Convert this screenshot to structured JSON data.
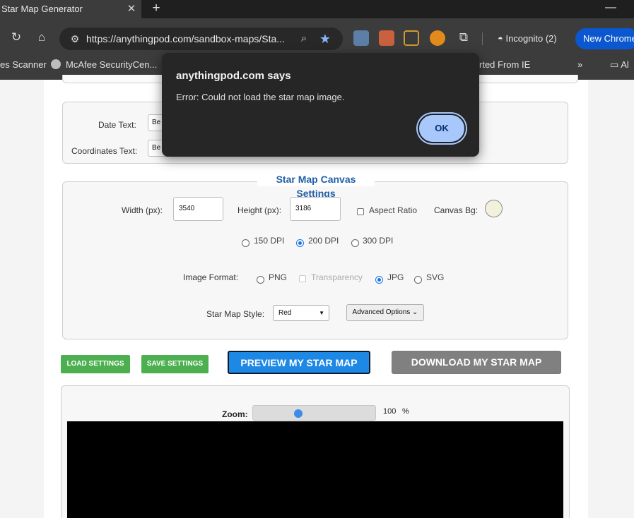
{
  "browser": {
    "tab_title": "Star Map Generator",
    "tab_close": "✕",
    "new_tab": "+",
    "minimize": "—",
    "url": "https://anythingpod.com/sandbox-maps/Sta...",
    "incognito_label": "Incognito (2)",
    "new_chrome_label": "New Chrome",
    "bookmarks": [
      "es Scanner",
      "McAfee SecurityCen...",
      "rted From IE",
      "Al"
    ],
    "bookmarks_overflow": "»"
  },
  "text_settings": {
    "date_label": "Date Text:",
    "date_value": "Be",
    "coords_label": "Coordinates Text:",
    "coords_value": "Be"
  },
  "canvas_settings": {
    "legend": "Star Map Canvas Settings",
    "width_label": "Width (px):",
    "width_value": "3540",
    "height_label": "Height (px):",
    "height_value": "3186",
    "aspect_label": "Aspect Ratio",
    "canvas_bg_label": "Canvas Bg:",
    "canvas_bg_color": "#f2f2dc",
    "dpi_options": [
      "150 DPI",
      "200 DPI",
      "300 DPI"
    ],
    "dpi_selected": "200 DPI",
    "format_label": "Image Format:",
    "format_options": [
      "PNG",
      "Transparency",
      "JPG",
      "SVG"
    ],
    "format_selected": "JPG",
    "style_label": "Star Map Style:",
    "style_value": "Red",
    "advanced_label": "Advanced Options"
  },
  "actions": {
    "load_settings": "LOAD SETTINGS",
    "save_settings": "SAVE SETTINGS",
    "preview": "PREVIEW MY STAR MAP",
    "download": "DOWNLOAD MY STAR MAP"
  },
  "preview": {
    "zoom_label": "Zoom:",
    "zoom_value": "100",
    "zoom_unit": "%",
    "zoom_fraction": 0.36
  },
  "dialog": {
    "title": "anythingpod.com says",
    "message": "Error: Could not load the star map image.",
    "ok_label": "OK"
  },
  "colors": {
    "accent_blue": "#1e88e5",
    "green_button": "#4caf50",
    "grey_button": "#808080",
    "legend_blue": "#1f5fa8",
    "dialog_ok": "#a8c7fa"
  }
}
